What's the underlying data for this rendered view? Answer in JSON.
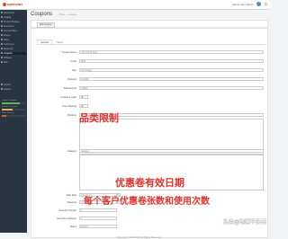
{
  "header": {
    "logo": "opencart",
    "user": "admin user Admin",
    "logout": "Logout"
  },
  "sidebar": {
    "items": [
      "Dashboard",
      "Catalog",
      "Product Bundles",
      "Extensions",
      "Special Offers",
      "Design",
      "Sales",
      "Customers",
      "Marketing",
      "Coupons",
      "Affiliates",
      "Mail",
      "System",
      "Reports"
    ],
    "stats": [
      {
        "label": "Orders Completed",
        "pct": 0.75,
        "color": "#5cb85c"
      },
      {
        "label": "Orders Processing",
        "pct": 0.45,
        "color": "#f0ad4e"
      },
      {
        "label": "Other Statuses",
        "pct": 0.2,
        "color": "#d9534f"
      }
    ]
  },
  "page": {
    "title": "Coupons",
    "breadcrumb": [
      "Home",
      "Coupons"
    ],
    "save_label": "Edit Coupon"
  },
  "tabs": [
    "General",
    "History"
  ],
  "form": {
    "coupon_name": {
      "label": "* Coupon Name",
      "value": "-10% Off All Items"
    },
    "code": {
      "label": "* Code",
      "value": "2222"
    },
    "type": {
      "label": "Type",
      "value": "Percentage"
    },
    "discount": {
      "label": "Discount",
      "value": "10.0000"
    },
    "total_amount": {
      "label": "Total Amount",
      "value": "0.0000"
    },
    "customer_login": {
      "label": "Customer Login",
      "value": "No"
    },
    "free_shipping": {
      "label": "Free Shipping",
      "value": "No"
    },
    "products": {
      "label": "Products",
      "placeholder": "Products"
    },
    "category": {
      "label": "Category",
      "placeholder": "Category"
    },
    "date_start": {
      "label": "Date Start",
      "value": "2022-11-15"
    },
    "date_end": {
      "label": "Date End",
      "value": "2022-11-28"
    },
    "uses_per_coupon": {
      "label": "Uses Per Coupon",
      "value": "1"
    },
    "uses_per_customer": {
      "label": "Uses Per Customer",
      "value": "1"
    },
    "status": {
      "label": "Status",
      "value": "Enabled"
    }
  },
  "annotations": {
    "category_limit": "品类限制",
    "validity": "优惠卷有效日期",
    "usage": "每个客户优惠卷张数和使用次数"
  },
  "footer": "OpenCart © 2009-2022 All Rights Reserved.",
  "watermark": "头条@跨境平头哥"
}
